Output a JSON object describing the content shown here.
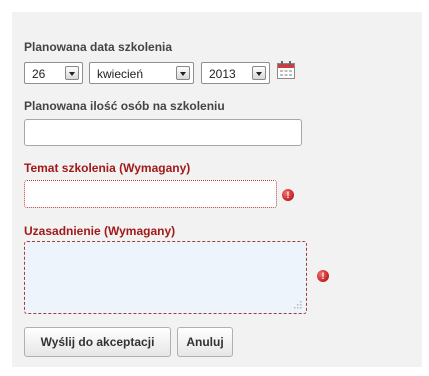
{
  "form": {
    "date_label": "Planowana data szkolenia",
    "day": "26",
    "month": "kwiecień",
    "year": "2013",
    "people_label": "Planowana ilość osób na szkoleniu",
    "people_value": "",
    "topic_label": "Temat szkolenia (Wymagany)",
    "topic_value": "",
    "justification_label": "Uzasadnienie (Wymagany)",
    "justification_value": "",
    "error_icon_glyph": "!",
    "submit_label": "Wyślij do akceptacji",
    "cancel_label": "Anuluj"
  },
  "icons": [
    "calendar-icon",
    "error-icon",
    "resize-grip-icon"
  ],
  "colors": {
    "required_label": "#a11a1a",
    "error_icon": "#c22020",
    "panel_bg": "#f2f2f2"
  }
}
